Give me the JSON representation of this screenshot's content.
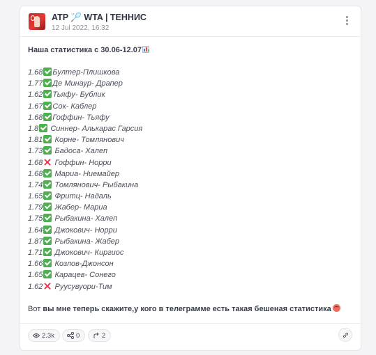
{
  "post": {
    "channel_title_left": "ATP",
    "channel_title_right": "WTA | ТЕННИС",
    "date": "12 Jul 2022, 16:32",
    "intro": "Наша статистика с 30.06-12.07",
    "rows": [
      {
        "odds": "1.68",
        "result": "win",
        "match": "Бултер-Плишкова"
      },
      {
        "odds": "1.77",
        "result": "win",
        "match": "Де Минаур- Драпер"
      },
      {
        "odds": "1.62",
        "result": "win",
        "match": "Тьяфу- Бублик"
      },
      {
        "odds": "1.67",
        "result": "win",
        "match": "Сок- Каблер"
      },
      {
        "odds": "1.68",
        "result": "win",
        "match": "Гоффин- Тьяфу"
      },
      {
        "odds": "1.8",
        "result": "win",
        "match": " Синнер- Алькарас Гарсия"
      },
      {
        "odds": "1.81",
        "result": "win",
        "match": " Корне- Томлянович"
      },
      {
        "odds": "1.73",
        "result": "win",
        "match": " Бадоса- Халеп"
      },
      {
        "odds": "1.68",
        "result": "loss",
        "match": " Гоффин- Норри"
      },
      {
        "odds": "1.68",
        "result": "win",
        "match": " Мариа- Ниемайер"
      },
      {
        "odds": "1.74",
        "result": "win",
        "match": " Томлянович- Рыбакина"
      },
      {
        "odds": "1.65",
        "result": "win",
        "match": " Фритц- Надаль"
      },
      {
        "odds": "1.79",
        "result": "win",
        "match": " Жабер- Мариа"
      },
      {
        "odds": "1.75",
        "result": "win",
        "match": " Рыбакина- Халеп"
      },
      {
        "odds": "1.64",
        "result": "win",
        "match": " Джокович- Норри"
      },
      {
        "odds": "1.87",
        "result": "win",
        "match": " Рыбакина- Жабер"
      },
      {
        "odds": "1.71",
        "result": "win",
        "match": " Джокович- Киргиос"
      },
      {
        "odds": "1.66",
        "result": "win",
        "match": " Козлов-Джонсон"
      },
      {
        "odds": "1.65",
        "result": "win",
        "match": " Карацев- Сонего"
      },
      {
        "odds": "1.62",
        "result": "loss",
        "match": " Руусувуори-Тим"
      }
    ],
    "outro_normal": "Вот",
    "outro_bold": " вы мне теперь скажите,у кого в телеграмме есть такая бешеная статистика"
  },
  "footer": {
    "views": "2.3k",
    "shares": "0",
    "forwards": "2"
  },
  "icons": {
    "more": "vertical-dots-icon",
    "chart": "bar-chart-icon",
    "win": "check-mark-icon",
    "loss": "cross-mark-icon",
    "views": "eye-icon",
    "shares": "share-icon",
    "forwards": "forward-arrow-icon",
    "link": "link-icon"
  },
  "colors": {
    "win": "#4caf50",
    "loss": "#e53950",
    "accent_pin": "#e0669a"
  }
}
